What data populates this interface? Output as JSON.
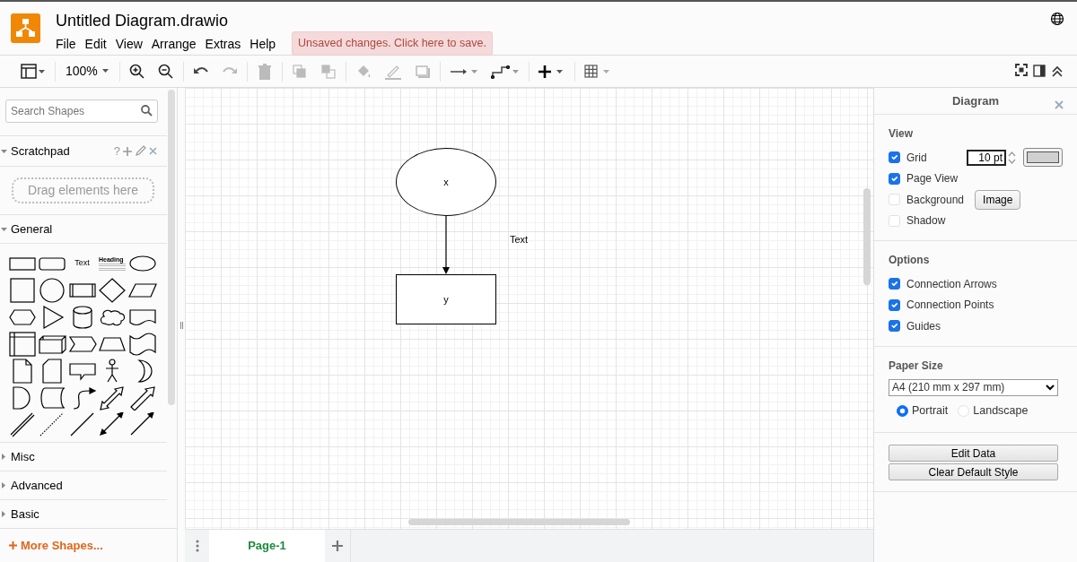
{
  "window": {
    "title": "Untitled Diagram.drawio"
  },
  "menu": [
    {
      "label": "File"
    },
    {
      "label": "Edit"
    },
    {
      "label": "View"
    },
    {
      "label": "Arrange"
    },
    {
      "label": "Extras"
    },
    {
      "label": "Help"
    }
  ],
  "save_notice": "Unsaved changes. Click here to save.",
  "toolbar": {
    "zoom": "100%"
  },
  "sidebar": {
    "search": {
      "placeholder": "Search Shapes"
    },
    "scratchpad": {
      "title": "Scratchpad",
      "help": "?",
      "drop_hint": "Drag elements here",
      "expanded": true
    },
    "shape_text": "Text",
    "shape_heading": "Heading",
    "sections": [
      {
        "title": "General",
        "expanded": true
      },
      {
        "title": "Misc",
        "expanded": false
      },
      {
        "title": "Advanced",
        "expanded": false
      },
      {
        "title": "Basic",
        "expanded": false
      }
    ],
    "more_shapes": "More Shapes..."
  },
  "diagram": {
    "nodes": [
      {
        "kind": "ellipse",
        "label": "x"
      },
      {
        "kind": "rect",
        "label": "y"
      },
      {
        "kind": "text",
        "label": "Text"
      }
    ]
  },
  "pages": [
    {
      "label": "Page-1",
      "selected": true
    }
  ],
  "format_panel": {
    "title": "Diagram",
    "view": {
      "title": "View",
      "options": [
        {
          "kind": "grid",
          "label": "Grid",
          "checked": true,
          "size": "10 pt"
        },
        {
          "kind": "check",
          "label": "Page View",
          "checked": true
        },
        {
          "kind": "background",
          "label": "Background",
          "checked": false,
          "button": "Image"
        },
        {
          "kind": "check",
          "label": "Shadow",
          "checked": false
        }
      ]
    },
    "options": {
      "title": "Options",
      "options": [
        {
          "label": "Connection Arrows",
          "checked": true
        },
        {
          "label": "Connection Points",
          "checked": true
        },
        {
          "label": "Guides",
          "checked": true
        }
      ]
    },
    "paper": {
      "title": "Paper Size",
      "size": "A4 (210 mm x 297 mm)",
      "orientations": [
        {
          "label": "Portrait",
          "selected": true
        },
        {
          "label": "Landscape",
          "selected": false
        }
      ]
    },
    "buttons": [
      {
        "label": "Edit Data"
      },
      {
        "label": "Clear Default Style"
      }
    ]
  }
}
